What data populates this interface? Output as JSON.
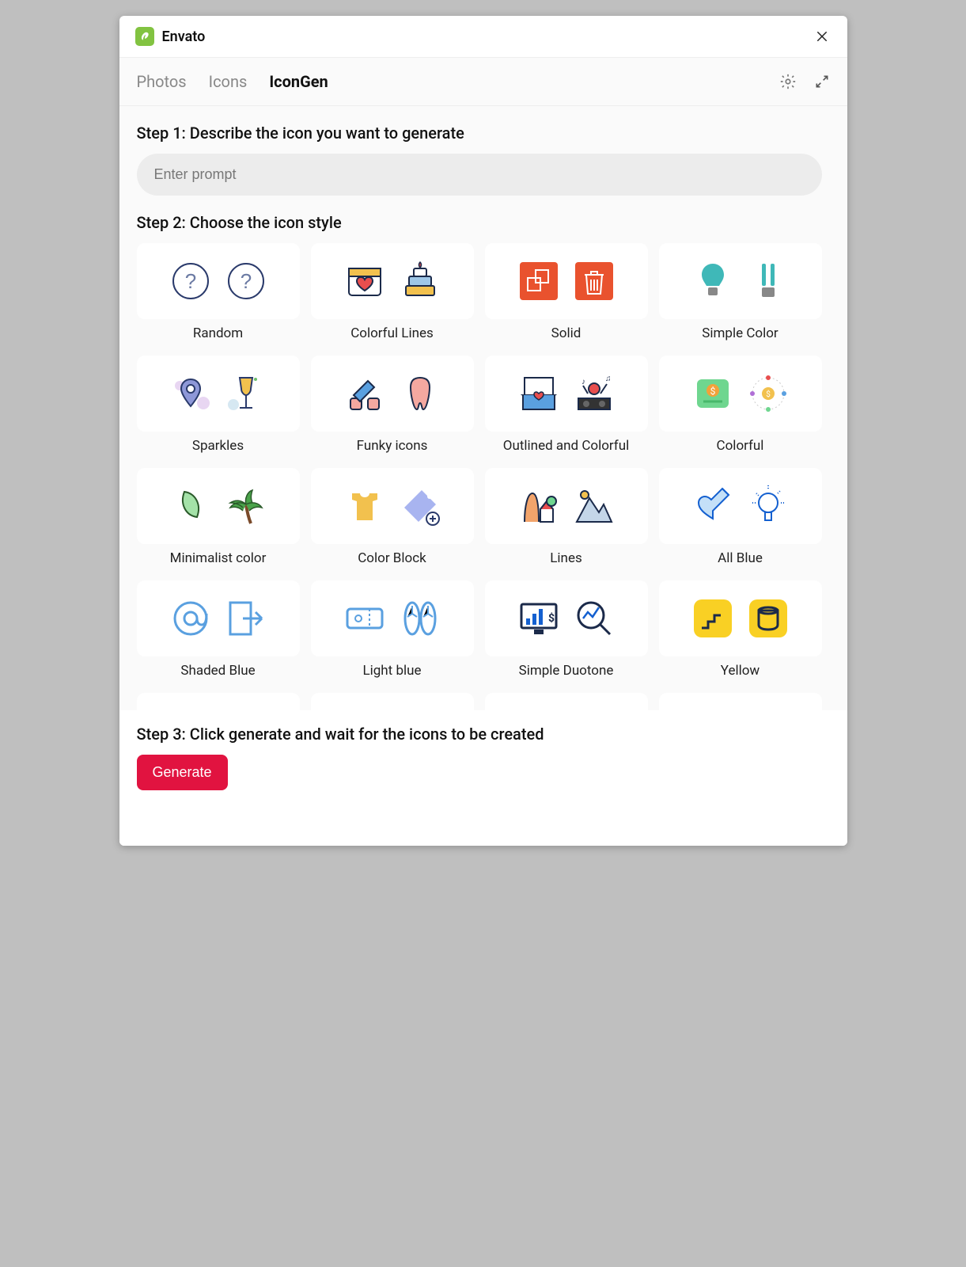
{
  "brand": "Envato",
  "tabs": [
    {
      "label": "Photos",
      "active": false
    },
    {
      "label": "Icons",
      "active": false
    },
    {
      "label": "IconGen",
      "active": true
    }
  ],
  "step1_label": "Step 1: Describe the icon you want to generate",
  "prompt_placeholder": "Enter prompt",
  "prompt_value": "",
  "step2_label": "Step 2: Choose the icon style",
  "styles": [
    {
      "label": "Random"
    },
    {
      "label": "Colorful Lines"
    },
    {
      "label": "Solid"
    },
    {
      "label": "Simple Color"
    },
    {
      "label": "Sparkles"
    },
    {
      "label": "Funky icons"
    },
    {
      "label": "Outlined and Colorful"
    },
    {
      "label": "Colorful"
    },
    {
      "label": "Minimalist color"
    },
    {
      "label": "Color Block"
    },
    {
      "label": "Lines"
    },
    {
      "label": "All Blue"
    },
    {
      "label": "Shaded Blue"
    },
    {
      "label": "Light blue"
    },
    {
      "label": "Simple Duotone"
    },
    {
      "label": "Yellow"
    }
  ],
  "step3_label": "Step 3: Click generate and wait for the icons to be created",
  "generate_label": "Generate"
}
